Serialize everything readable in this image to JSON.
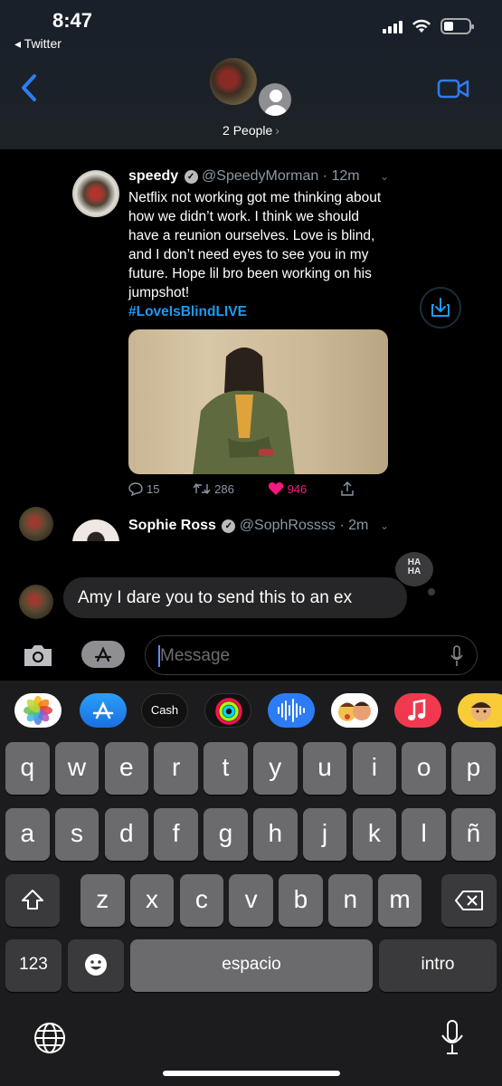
{
  "status_bar": {
    "time": "8:47",
    "back_app": "◂ Twitter"
  },
  "header": {
    "people_label": "2 People",
    "people_chevron": "›"
  },
  "tweet": {
    "name": "speedy",
    "handle_time": "@SpeedyMorman · 12m",
    "text": "Netflix not working got me thinking about how we didn’t work. I think we should have a reunion ourselves. Love is blind, and I don’t need eyes to see you in my future. Hope lil bro been working on his jumpshot!",
    "hashtag": "#LoveIsBlindLIVE",
    "replies": "15",
    "retweets": "286",
    "likes": "946"
  },
  "tweet2": {
    "name": "Sophie Ross",
    "handle_time": "@SophRossss · 2m"
  },
  "tapback": {
    "text": "HA HA"
  },
  "message": {
    "text": "Amy I dare you to send this to an ex"
  },
  "composer": {
    "placeholder": "Message"
  },
  "app_strip": {
    "cash_label": "Cash"
  },
  "keyboard": {
    "row1": [
      "q",
      "w",
      "e",
      "r",
      "t",
      "y",
      "u",
      "i",
      "o",
      "p"
    ],
    "row2": [
      "a",
      "s",
      "d",
      "f",
      "g",
      "h",
      "j",
      "k",
      "l",
      "ñ"
    ],
    "row3": [
      "z",
      "x",
      "c",
      "v",
      "b",
      "n",
      "m"
    ],
    "numbers_key": "123",
    "space_key": "espacio",
    "return_key": "intro"
  },
  "colors": {
    "accent": "#1d9bf0",
    "ios_blue": "#2e7cf6",
    "like": "#f91880"
  },
  "icons": [
    "back-chevron-icon",
    "video-camera-icon",
    "verified-icon",
    "share-icon",
    "camera-icon",
    "app-store-icon",
    "mic-icon",
    "shift-icon",
    "delete-icon",
    "emoji-icon",
    "globe-icon"
  ]
}
